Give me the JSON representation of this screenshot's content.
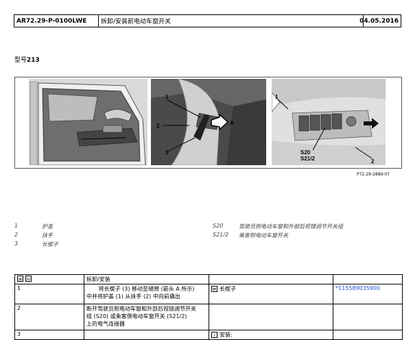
{
  "header": {
    "code": "AR72.29-P-0100LWE",
    "title": "拆卸/安装前电动车窗开关",
    "date": "04.05.2016"
  },
  "model": {
    "label": "型号",
    "value": "213"
  },
  "figure": {
    "callouts": {
      "p1_1": "1",
      "p1_2": "2",
      "p1_3": "3",
      "p1_A": "A",
      "p2_1": "1",
      "p2_s20": "S20",
      "p2_s212": "S21/2",
      "p2_2": "2"
    },
    "code": "P72.29-2889-07"
  },
  "legend": [
    {
      "key": "1",
      "text": "护盖"
    },
    {
      "key": "2",
      "text": "扶手"
    },
    {
      "key": "3",
      "text": "长楔子"
    },
    {
      "key": "S20",
      "text": "驾驶员侧电动车窗和外部后视镜调节开关组"
    },
    {
      "key": "S21/2",
      "text": "乘客侧电动车窗开关"
    }
  ],
  "steps_table": {
    "header_label": "拆卸/安装",
    "rows": [
      {
        "num": "1",
        "text_a": "将长楔子 (3) 移动至缝隙 (箭头 A 所示)",
        "text_b": "中并将护盖 (1) 从扶手 (2) 中向前撬出",
        "tool": "长楔子",
        "part": "*115589035900"
      },
      {
        "num": "2",
        "text_a": "断开驾驶员侧电动车窗和外部后视镜调节开关",
        "text_b": "组 (S20) 或乘客侧电动车窗开关 (S21/2)",
        "text_c": "上的电气连接器",
        "tool": "",
        "part": ""
      },
      {
        "num": "3",
        "text_a": "",
        "text_b": "",
        "tool": "安装:",
        "part": ""
      }
    ]
  }
}
